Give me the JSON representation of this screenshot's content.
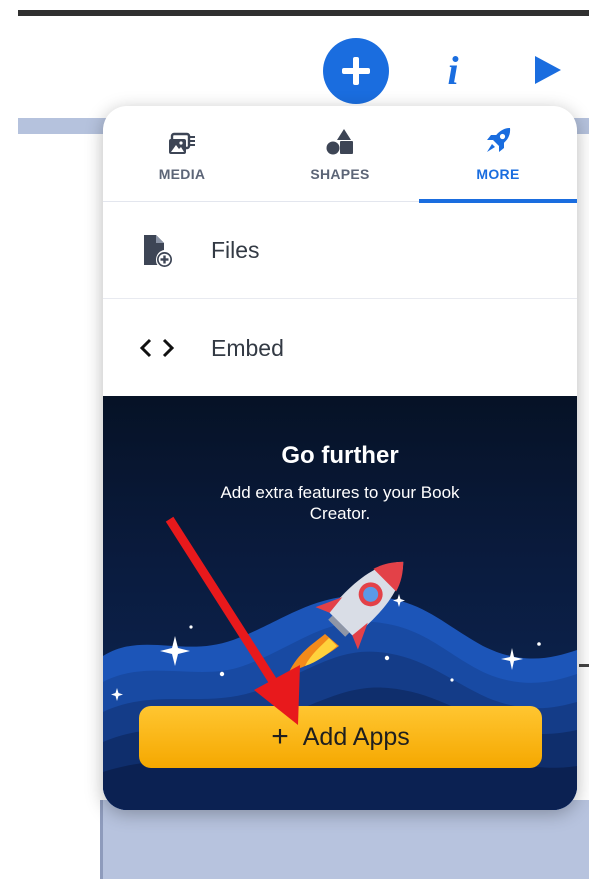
{
  "toolbar": {
    "add_icon": "plus-icon",
    "info_glyph": "i",
    "info_icon": "info-icon",
    "play_icon": "play-icon"
  },
  "tabs": [
    {
      "label": "MEDIA",
      "icon": "media-icon",
      "active": false
    },
    {
      "label": "SHAPES",
      "icon": "shapes-icon",
      "active": false
    },
    {
      "label": "MORE",
      "icon": "rocket-icon",
      "active": true
    }
  ],
  "menu": [
    {
      "label": "Files",
      "icon": "file-add-icon"
    },
    {
      "label": "Embed",
      "icon": "code-icon"
    }
  ],
  "promo": {
    "title": "Go further",
    "body": "Add extra features to your Book Creator.",
    "button_plus": "+",
    "button_label": "Add Apps"
  },
  "colors": {
    "accent": "#1a6ddf",
    "button": "#f9b81a",
    "promo_background": "#0a1b3e",
    "arrow": "#e8191c"
  }
}
